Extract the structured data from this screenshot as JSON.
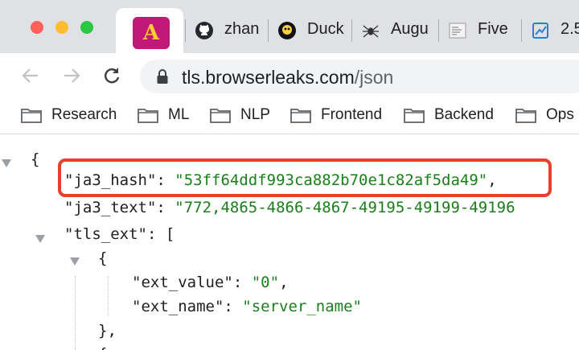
{
  "tabs": [
    {
      "icon": "github-icon",
      "label": "zhan"
    },
    {
      "icon": "duckduckgo-icon",
      "label": "Duck"
    },
    {
      "icon": "spider-icon",
      "label": "Augu"
    },
    {
      "icon": "document-icon",
      "label": "Five"
    },
    {
      "icon": "chart-icon",
      "label": "2.5"
    }
  ],
  "address_bar": {
    "host": "tls.browserleaks.com",
    "path": "/json"
  },
  "bookmarks": [
    "Research",
    "ML",
    "NLP",
    "Frontend",
    "Backend",
    "Ops"
  ],
  "json_view": {
    "open_brace": "{",
    "ja3_hash_key": "\"ja3_hash\"",
    "ja3_hash_value": "\"53ff64ddf993ca882b70e1c82af5da49\"",
    "ja3_text_key": "\"ja3_text\"",
    "ja3_text_value": "\"772,4865-4866-4867-49195-49199-49196",
    "tls_ext_key": "\"tls_ext\"",
    "array_open": "[",
    "object_open": "{",
    "ext_value_key": "\"ext_value\"",
    "ext_value_value": "\"0\"",
    "ext_name_key": "\"ext_name\"",
    "ext_name_value": "\"server_name\"",
    "object_close": "},",
    "next_object_open": "{"
  },
  "colors": {
    "string": "#1a7f1a",
    "highlight_border": "#e8402c",
    "active_tab_favicon": "#c2187a"
  }
}
